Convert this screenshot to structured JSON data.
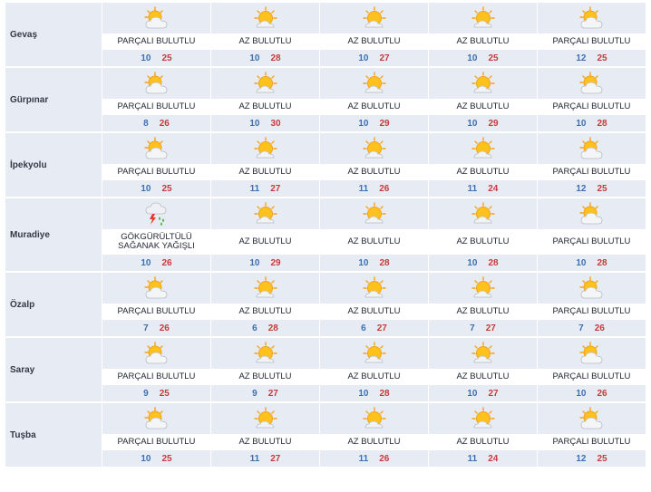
{
  "colors": {
    "min_temp": "#3d6fb3",
    "max_temp": "#c43b3b",
    "row_bg": "#e7ecf4"
  },
  "rows": [
    {
      "city": "Gevaş",
      "days": [
        {
          "icon": "partly-cloudy-icon",
          "desc": "PARÇALI BULUTLU",
          "min": "10",
          "max": "25"
        },
        {
          "icon": "mostly-sunny-icon",
          "desc": "AZ BULUTLU",
          "min": "10",
          "max": "28"
        },
        {
          "icon": "mostly-sunny-icon",
          "desc": "AZ BULUTLU",
          "min": "10",
          "max": "27"
        },
        {
          "icon": "mostly-sunny-icon",
          "desc": "AZ BULUTLU",
          "min": "10",
          "max": "25"
        },
        {
          "icon": "partly-cloudy-icon",
          "desc": "PARÇALI BULUTLU",
          "min": "12",
          "max": "25"
        }
      ]
    },
    {
      "city": "Gürpınar",
      "days": [
        {
          "icon": "partly-cloudy-icon",
          "desc": "PARÇALI BULUTLU",
          "min": "8",
          "max": "26"
        },
        {
          "icon": "mostly-sunny-icon",
          "desc": "AZ BULUTLU",
          "min": "10",
          "max": "30"
        },
        {
          "icon": "mostly-sunny-icon",
          "desc": "AZ BULUTLU",
          "min": "10",
          "max": "29"
        },
        {
          "icon": "mostly-sunny-icon",
          "desc": "AZ BULUTLU",
          "min": "10",
          "max": "29"
        },
        {
          "icon": "partly-cloudy-icon",
          "desc": "PARÇALI BULUTLU",
          "min": "10",
          "max": "28"
        }
      ]
    },
    {
      "city": "İpekyolu",
      "days": [
        {
          "icon": "partly-cloudy-icon",
          "desc": "PARÇALI BULUTLU",
          "min": "10",
          "max": "25"
        },
        {
          "icon": "mostly-sunny-icon",
          "desc": "AZ BULUTLU",
          "min": "11",
          "max": "27"
        },
        {
          "icon": "mostly-sunny-icon",
          "desc": "AZ BULUTLU",
          "min": "11",
          "max": "26"
        },
        {
          "icon": "mostly-sunny-icon",
          "desc": "AZ BULUTLU",
          "min": "11",
          "max": "24"
        },
        {
          "icon": "partly-cloudy-icon",
          "desc": "PARÇALI BULUTLU",
          "min": "12",
          "max": "25"
        }
      ]
    },
    {
      "city": "Muradiye",
      "days": [
        {
          "icon": "thunder-shower-icon",
          "desc": "GÖKGÜRÜLTÜLÜ SAĞANAK YAĞIŞLI",
          "min": "10",
          "max": "26"
        },
        {
          "icon": "mostly-sunny-icon",
          "desc": "AZ BULUTLU",
          "min": "10",
          "max": "29"
        },
        {
          "icon": "mostly-sunny-icon",
          "desc": "AZ BULUTLU",
          "min": "10",
          "max": "28"
        },
        {
          "icon": "mostly-sunny-icon",
          "desc": "AZ BULUTLU",
          "min": "10",
          "max": "28"
        },
        {
          "icon": "partly-cloudy-icon",
          "desc": "PARÇALI BULUTLU",
          "min": "10",
          "max": "28"
        }
      ]
    },
    {
      "city": "Özalp",
      "days": [
        {
          "icon": "partly-cloudy-icon",
          "desc": "PARÇALI BULUTLU",
          "min": "7",
          "max": "26"
        },
        {
          "icon": "mostly-sunny-icon",
          "desc": "AZ BULUTLU",
          "min": "6",
          "max": "28"
        },
        {
          "icon": "mostly-sunny-icon",
          "desc": "AZ BULUTLU",
          "min": "6",
          "max": "27"
        },
        {
          "icon": "mostly-sunny-icon",
          "desc": "AZ BULUTLU",
          "min": "7",
          "max": "27"
        },
        {
          "icon": "partly-cloudy-icon",
          "desc": "PARÇALI BULUTLU",
          "min": "7",
          "max": "26"
        }
      ]
    },
    {
      "city": "Saray",
      "days": [
        {
          "icon": "partly-cloudy-icon",
          "desc": "PARÇALI BULUTLU",
          "min": "9",
          "max": "25"
        },
        {
          "icon": "mostly-sunny-icon",
          "desc": "AZ BULUTLU",
          "min": "9",
          "max": "27"
        },
        {
          "icon": "mostly-sunny-icon",
          "desc": "AZ BULUTLU",
          "min": "10",
          "max": "28"
        },
        {
          "icon": "mostly-sunny-icon",
          "desc": "AZ BULUTLU",
          "min": "10",
          "max": "27"
        },
        {
          "icon": "partly-cloudy-icon",
          "desc": "PARÇALI BULUTLU",
          "min": "10",
          "max": "26"
        }
      ]
    },
    {
      "city": "Tuşba",
      "days": [
        {
          "icon": "partly-cloudy-icon",
          "desc": "PARÇALI BULUTLU",
          "min": "10",
          "max": "25"
        },
        {
          "icon": "mostly-sunny-icon",
          "desc": "AZ BULUTLU",
          "min": "11",
          "max": "27"
        },
        {
          "icon": "mostly-sunny-icon",
          "desc": "AZ BULUTLU",
          "min": "11",
          "max": "26"
        },
        {
          "icon": "mostly-sunny-icon",
          "desc": "AZ BULUTLU",
          "min": "11",
          "max": "24"
        },
        {
          "icon": "partly-cloudy-icon",
          "desc": "PARÇALI BULUTLU",
          "min": "12",
          "max": "25"
        }
      ]
    }
  ]
}
